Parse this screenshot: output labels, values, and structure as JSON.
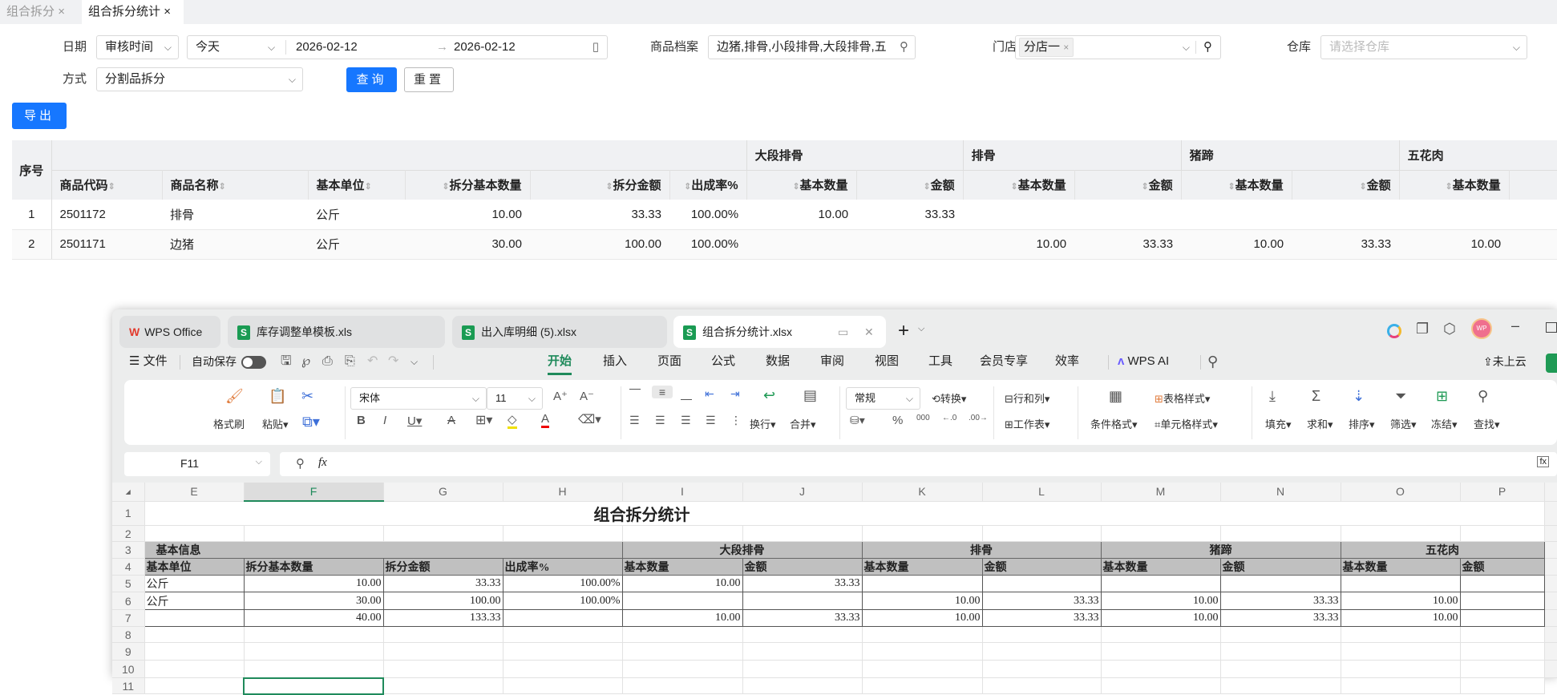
{
  "tabs": [
    {
      "label": "组合拆分",
      "close": "×"
    },
    {
      "label": "组合拆分统计",
      "close": "×"
    }
  ],
  "filters": {
    "date_label": "日期",
    "date_type": "审核时间",
    "date_preset": "今天",
    "date_start": "2026-02-12",
    "date_arrow": "→",
    "date_end": "2026-02-12",
    "product_label": "商品档案",
    "product_value": "边猪,排骨,小段排骨,大段排骨,五",
    "store_label": "门店",
    "store_tag": "分店一",
    "store_tag_close": "×",
    "warehouse_label": "仓库",
    "warehouse_placeholder": "请选择仓库",
    "method_label": "方式",
    "method_value": "分割品拆分",
    "query": "查询",
    "reset": "重置",
    "export": "导出"
  },
  "web_table": {
    "index_header": "序号",
    "groups": [
      "大段排骨",
      "排骨",
      "猪蹄",
      "五花肉"
    ],
    "columns": [
      "商品代码",
      "商品名称",
      "基本单位",
      "拆分基本数量",
      "拆分金额",
      "出成率%",
      "基本数量",
      "金额",
      "基本数量",
      "金额",
      "基本数量",
      "金额",
      "基本数量"
    ],
    "rows": [
      [
        "1",
        "2501172",
        "排骨",
        "公斤",
        "10.00",
        "33.33",
        "100.00%",
        "10.00",
        "33.33",
        "",
        "",
        "",
        "",
        ""
      ],
      [
        "2",
        "2501171",
        "边猪",
        "公斤",
        "30.00",
        "100.00",
        "100.00%",
        "",
        "",
        "10.00",
        "33.33",
        "10.00",
        "33.33",
        "10.00"
      ]
    ]
  },
  "wps": {
    "tabs": [
      "WPS Office",
      "库存调整单模板.xls",
      "出入库明细 (5).xlsx",
      "组合拆分统计.xlsx"
    ],
    "menu": {
      "file": "文件",
      "autosave": "自动保存",
      "items": [
        "开始",
        "插入",
        "页面",
        "公式",
        "数据",
        "审阅",
        "视图",
        "工具",
        "会员专享",
        "效率"
      ],
      "ai": "WPS AI",
      "cloud": "未上云",
      "avatar": "WP"
    },
    "ribbon": {
      "format_painter": "格式刷",
      "paste": "粘贴",
      "font": "宋体",
      "size": "11",
      "wrap": "换行",
      "merge": "合并",
      "number_format": "常规",
      "convert": "转换",
      "rows_cols": "行和列",
      "worksheet": "工作表",
      "cond_format": "条件格式",
      "table_style": "表格样式",
      "cell_style": "单元格样式",
      "fill": "填充",
      "sum": "求和",
      "sort": "排序",
      "filter": "筛选",
      "freeze": "冻结",
      "find": "查找"
    },
    "name_box": "F11",
    "fx": "fx",
    "sheet": {
      "columns": [
        "E",
        "F",
        "G",
        "H",
        "I",
        "J",
        "K",
        "L",
        "M",
        "N",
        "O",
        "P"
      ],
      "selected_col": "F",
      "title": "组合拆分统计",
      "group_basic": "基本信息",
      "groups": [
        "大段排骨",
        "排骨",
        "猪蹄",
        "五花肉"
      ],
      "headers": [
        "基本单位",
        "拆分基本数量",
        "拆分金额",
        "出成率%",
        "基本数量",
        "金额",
        "基本数量",
        "金额",
        "基本数量",
        "金额",
        "基本数量",
        "金额"
      ],
      "data": [
        [
          "公斤",
          "10.00",
          "33.33",
          "100.00%",
          "10.00",
          "33.33",
          "",
          "",
          "",
          "",
          "",
          ""
        ],
        [
          "公斤",
          "30.00",
          "100.00",
          "100.00%",
          "",
          "",
          "10.00",
          "33.33",
          "10.00",
          "33.33",
          "10.00",
          ""
        ],
        [
          "",
          "40.00",
          "133.33",
          "",
          "10.00",
          "33.33",
          "10.00",
          "33.33",
          "10.00",
          "33.33",
          "10.00",
          ""
        ]
      ]
    }
  }
}
